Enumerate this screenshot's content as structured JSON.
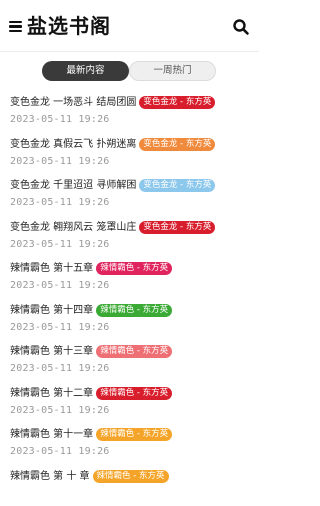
{
  "header": {
    "title": "盐选书阁",
    "menu_icon": "hamburger-menu-icon",
    "search_icon": "search-icon"
  },
  "tabs": [
    {
      "label": "最新内容",
      "active": true
    },
    {
      "label": "一周热门",
      "active": false
    }
  ],
  "colors": {
    "tag_red": "#d81e2c",
    "tag_orange": "#f08a3c",
    "tag_lightblue": "#8cc7ec",
    "tag_pink": "#e0245e",
    "tag_green": "#3aaa35",
    "tag_salmon": "#ee6f74",
    "tag_amber": "#f4a428"
  },
  "items": [
    {
      "title": "变色金龙 一场恶斗 结局团圆",
      "tag": "变色金龙 - 东方英",
      "tag_color": "#d81e2c",
      "time": "2023-05-11 19:26"
    },
    {
      "title": "变色金龙 真假云飞 扑朔迷离",
      "tag": "变色金龙 - 东方英",
      "tag_color": "#f08a3c",
      "time": "2023-05-11 19:26"
    },
    {
      "title": "变色金龙 千里迢迢 寻师解困",
      "tag": "变色金龙 - 东方英",
      "tag_color": "#8cc7ec",
      "time": "2023-05-11 19:26"
    },
    {
      "title": "变色金龙 翱翔风云 笼罩山庄",
      "tag": "变色金龙 - 东方英",
      "tag_color": "#d81e2c",
      "time": "2023-05-11 19:26"
    },
    {
      "title": "辣情霸色 第十五章",
      "tag": "辣情霸色 - 东方英",
      "tag_color": "#e0245e",
      "time": "2023-05-11 19:26"
    },
    {
      "title": "辣情霸色 第十四章",
      "tag": "辣情霸色 - 东方英",
      "tag_color": "#3aaa35",
      "time": "2023-05-11 19:26"
    },
    {
      "title": "辣情霸色 第十三章",
      "tag": "辣情霸色 - 东方英",
      "tag_color": "#ee6f74",
      "time": "2023-05-11 19:26"
    },
    {
      "title": "辣情霸色 第十二章",
      "tag": "辣情霸色 - 东方英",
      "tag_color": "#d81e2c",
      "time": "2023-05-11 19:26"
    },
    {
      "title": "辣情霸色 第十一章",
      "tag": "辣情霸色 - 东方英",
      "tag_color": "#f4a428",
      "time": "2023-05-11 19:26"
    },
    {
      "title": "辣情霸色 第 十 章",
      "tag": "辣情霸色 - 东方英",
      "tag_color": "#f4a428",
      "time": ""
    }
  ]
}
